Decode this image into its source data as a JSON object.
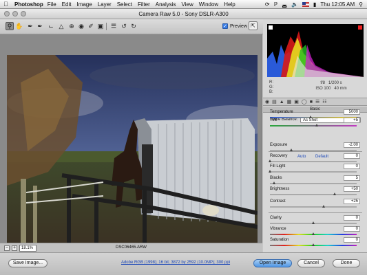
{
  "menubar": {
    "app": "Photoshop",
    "menus": [
      "File",
      "Edit",
      "Image",
      "Layer",
      "Select",
      "Filter",
      "Analysis",
      "View",
      "Window",
      "Help"
    ],
    "clock": "Thu 12:05 AM"
  },
  "window": {
    "title": "Camera Raw 5.0  -  Sony DSLR-A300"
  },
  "toolbar": {
    "preview_label": "Preview",
    "preview_checked": true
  },
  "zoom": {
    "value": "18.1%"
  },
  "image": {
    "filename": "DSC06465.ARW"
  },
  "readout": {
    "r": "R:",
    "g": "G:",
    "b": "B:",
    "aperture": "f/8",
    "shutter": "1/200 s",
    "iso": "ISO 100",
    "focal": "40 mm"
  },
  "panel": {
    "title": "Basic",
    "white_balance_label": "White Balance:",
    "white_balance_value": "As Shot",
    "auto_label": "Auto",
    "default_label": "Default",
    "sliders": [
      {
        "label": "Temperature",
        "value": "5000",
        "level": 0.47
      },
      {
        "label": "Tint",
        "value": "+5",
        "level": 0.54
      },
      {
        "label": "Exposure",
        "value": "-2.00",
        "level": 0.25
      },
      {
        "label": "Recovery",
        "value": "0",
        "level": 0.0
      },
      {
        "label": "Fill Light",
        "value": "0",
        "level": 0.0
      },
      {
        "label": "Blacks",
        "value": "5",
        "level": 0.05
      },
      {
        "label": "Brightness",
        "value": "+50",
        "level": 0.75
      },
      {
        "label": "Contrast",
        "value": "+25",
        "level": 0.62
      },
      {
        "label": "Clarity",
        "value": "0",
        "level": 0.5
      },
      {
        "label": "Vibrance",
        "value": "0",
        "level": 0.5
      },
      {
        "label": "Saturation",
        "value": "0",
        "level": 0.5
      }
    ]
  },
  "bottom": {
    "save_label": "Save Image...",
    "workflow_label": "Adobe RGB (1998); 16 bit; 3872 by 2592 (10.0MP); 300 ppi",
    "open_label": "Open Image",
    "cancel_label": "Cancel",
    "done_label": "Done"
  },
  "colors": {
    "accent": "#3b7ee5",
    "link": "#1a46b8"
  }
}
